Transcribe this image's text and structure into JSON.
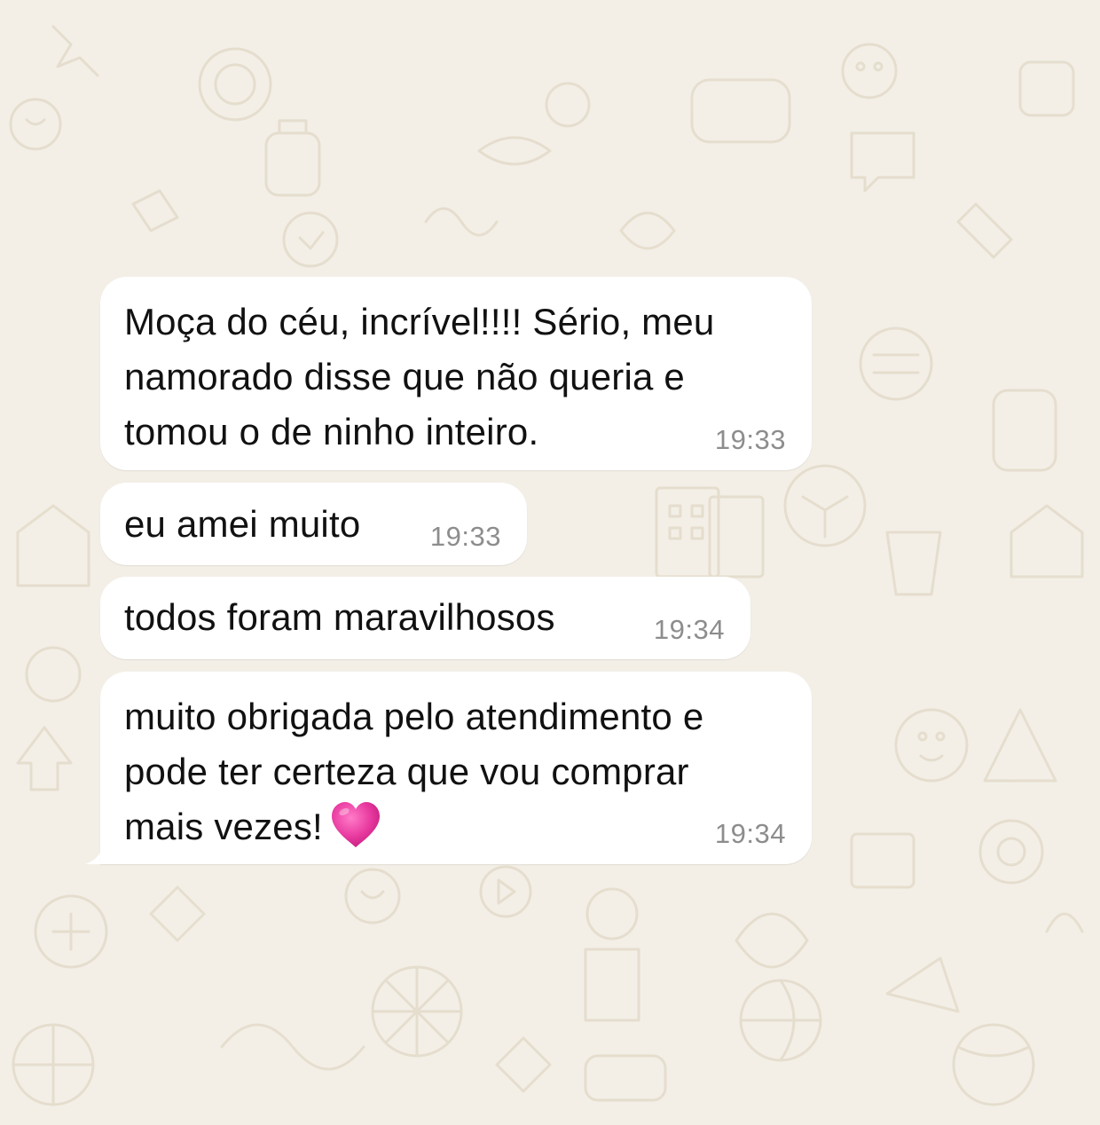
{
  "chat": {
    "messages": [
      {
        "text": "Moça do céu, incrível!!!! Sério, meu\nnamorado disse que não queria e\ntomou o de ninho inteiro.",
        "time": "19:33"
      },
      {
        "text": "eu amei muito",
        "time": "19:33"
      },
      {
        "text": "todos foram maravilhosos",
        "time": "19:34"
      },
      {
        "text": "muito obrigada pelo atendimento e\npode ter certeza que vou comprar\nmais vezes!",
        "time": "19:34",
        "emoji": "pink-heart-icon"
      }
    ]
  },
  "colors": {
    "background": "#f3efe7",
    "bubble": "#ffffff",
    "text": "#111111",
    "timestamp": "#8d8d8d",
    "heart": "#e8399f"
  }
}
